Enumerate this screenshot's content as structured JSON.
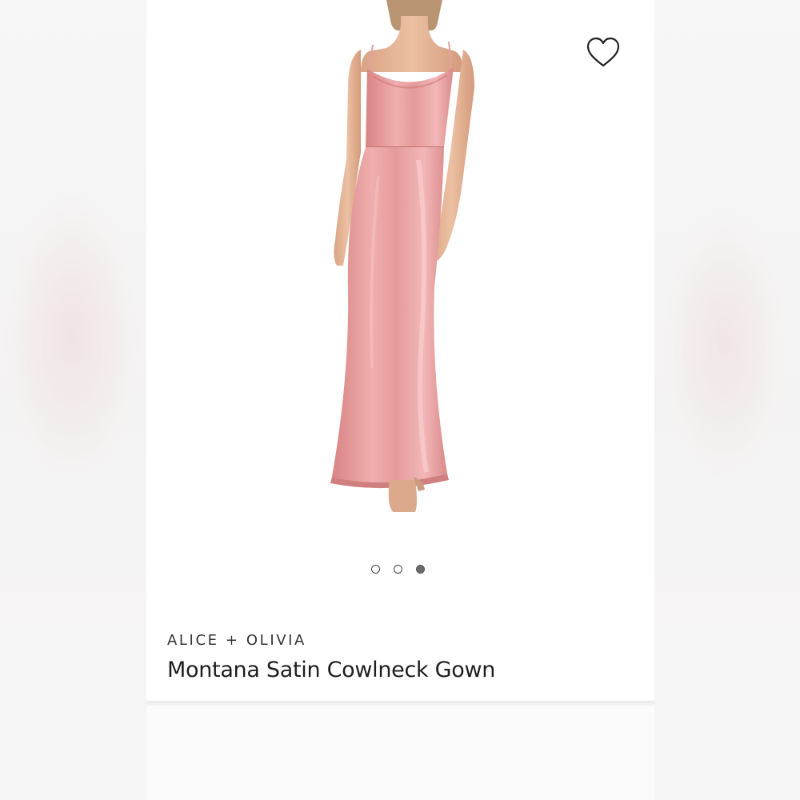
{
  "product": {
    "brand": "ALICE + OLIVIA",
    "title": "Montana Satin Cowlneck Gown",
    "image_description": "model wearing pink satin cowlneck slip gown"
  },
  "gallery": {
    "total_images": 3,
    "active_index": 3
  },
  "icons": {
    "favorite": "heart-outline-icon"
  },
  "colors": {
    "dress": "#e39a9a",
    "active_dot": "#6b6b6b",
    "title_text": "#1e1e1e"
  }
}
